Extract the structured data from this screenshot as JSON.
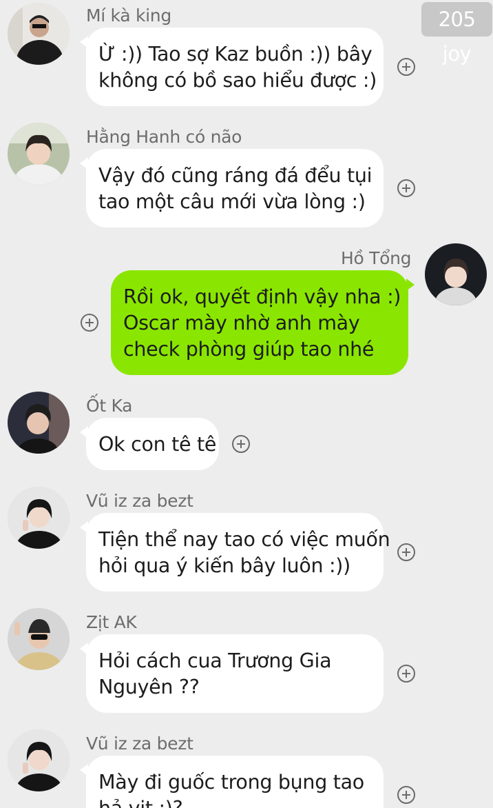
{
  "badge": {
    "label": "205 joy"
  },
  "messages": [
    {
      "sender": "Mí kà king",
      "lines": [
        "Ừ :)) Tao sợ Kaz buồn :)) bây",
        "không có bồ sao hiểu được :)"
      ],
      "direction": "incoming"
    },
    {
      "sender": "Hằng Hanh có não",
      "lines": [
        "Vậy đó cũng ráng đá đểu tụi",
        "tao một câu mới vừa lòng :)"
      ],
      "direction": "incoming"
    },
    {
      "sender": "Hồ Tổng",
      "lines": [
        "Rồi ok, quyết định vậy nha :)",
        "Oscar mày nhờ anh mày",
        "check phòng giúp tao nhé"
      ],
      "direction": "outgoing"
    },
    {
      "sender": "Ốt Ka",
      "lines": [
        "Ok con tê tê"
      ],
      "direction": "incoming"
    },
    {
      "sender": "Vũ iz za bezt",
      "lines": [
        "Tiện thể nay tao có việc muốn",
        "hỏi qua ý kiến bây luôn :))"
      ],
      "direction": "incoming"
    },
    {
      "sender": "Zịt AK",
      "lines": [
        "Hỏi cách cua Trương Gia",
        "Nguyên ??"
      ],
      "direction": "incoming"
    },
    {
      "sender": "Vũ iz za bezt",
      "lines": [
        "Mày đi guốc trong bụng tao",
        "hả vịt :)?"
      ],
      "direction": "incoming"
    }
  ],
  "colors": {
    "background": "#ededed",
    "incoming_bubble": "#ffffff",
    "outgoing_bubble": "#8ae600",
    "sender_text": "#6d6d6d"
  }
}
